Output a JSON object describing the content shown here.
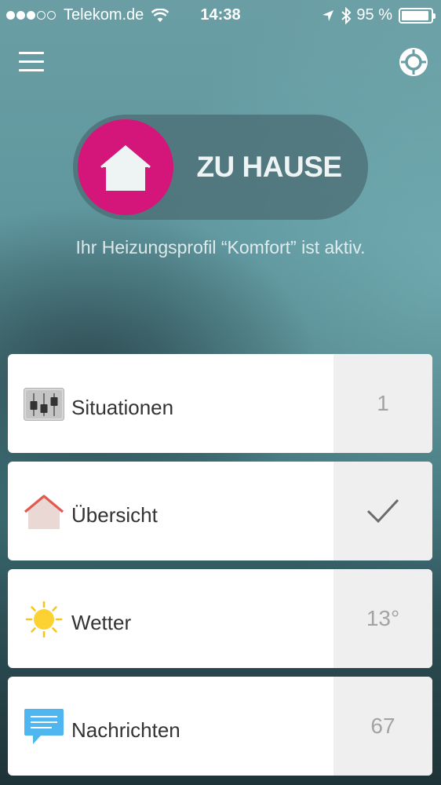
{
  "status_bar": {
    "carrier": "Telekom.de",
    "time": "14:38",
    "battery": "95 %",
    "battery_level": 0.95,
    "signal_bars_filled": 3,
    "signal_bars_total": 5
  },
  "header": {
    "menu_icon": "hamburger-menu-icon",
    "location_icon": "target-icon"
  },
  "mode": {
    "label": "ZU HAUSE",
    "icon": "house-icon",
    "knob_color": "#d4157a",
    "profile_text": "Ihr Heizungsprofil “Komfort” ist aktiv."
  },
  "cards": [
    {
      "label": "Situationen",
      "value": "1",
      "icon": "sliders-icon"
    },
    {
      "label": "Übersicht",
      "value": "",
      "icon": "house-outline-icon",
      "status_icon": "checkmark-icon"
    },
    {
      "label": "Wetter",
      "value": "13°",
      "icon": "sun-icon"
    },
    {
      "label": "Nachrichten",
      "value": "67",
      "icon": "message-bubble-icon"
    }
  ]
}
